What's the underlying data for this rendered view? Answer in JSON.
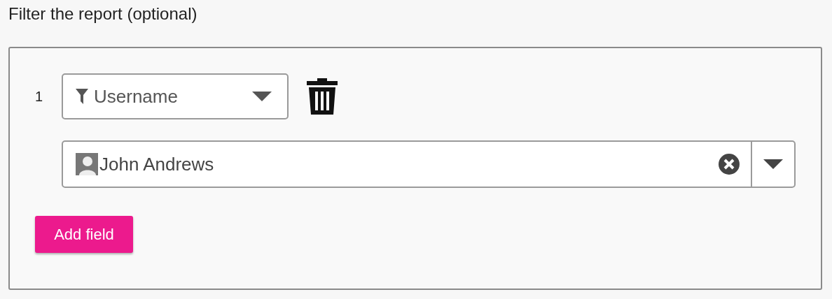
{
  "title": "Filter the report (optional)",
  "filters": [
    {
      "number": "1",
      "field": "Username",
      "value": "John Andrews"
    }
  ],
  "add_button": "Add field"
}
